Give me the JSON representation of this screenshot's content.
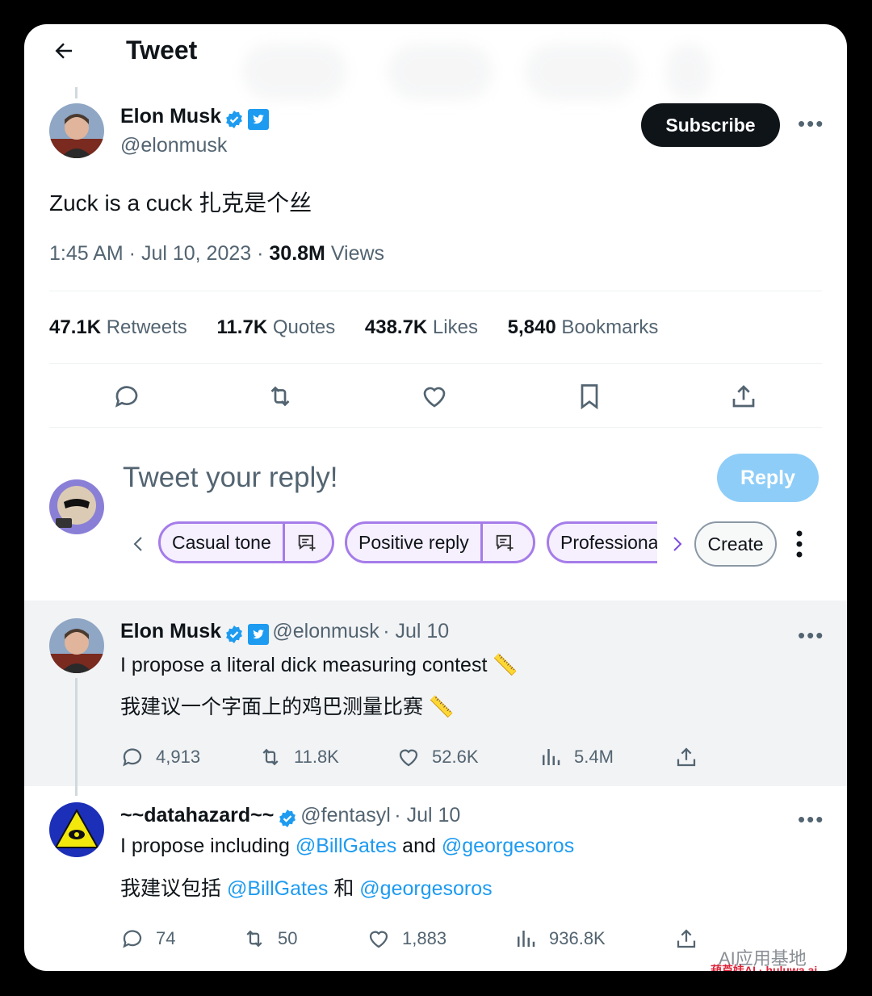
{
  "header": {
    "title": "Tweet"
  },
  "main_tweet": {
    "author_name": "Elon Musk",
    "handle": "@elonmusk",
    "subscribe_label": "Subscribe",
    "text": "Zuck is a cuck 扎克是个丝",
    "time": "1:45 AM · Jul 10, 2023 · ",
    "views_count": "30.8M",
    "views_label": " Views",
    "stats": [
      {
        "count": "47.1K",
        "label": " Retweets"
      },
      {
        "count": "11.7K",
        "label": " Quotes"
      },
      {
        "count": "438.7K",
        "label": " Likes"
      },
      {
        "count": "5,840",
        "label": " Bookmarks"
      }
    ]
  },
  "reply_composer": {
    "prompt": "Tweet your reply!",
    "reply_label": "Reply",
    "chips": [
      "Casual tone",
      "Positive reply",
      "Professional"
    ],
    "create_label": "Create"
  },
  "replies": [
    {
      "author_name": "Elon Musk",
      "handle": "@elonmusk",
      "date": "· Jul 10",
      "line1": "I propose a literal dick measuring contest 📏",
      "line2": "我建议一个字面上的鸡巴测量比赛 📏",
      "replies": "4,913",
      "retweets": "11.8K",
      "likes": "52.6K",
      "views": "5.4M"
    },
    {
      "author_name": "~~datahazard~~",
      "handle": "@fentasyl",
      "date": "· Jul 10",
      "line1_a": "I propose including ",
      "mention1": "@BillGates",
      "line1_b": " and ",
      "mention2": "@georgesoros",
      "line2_a": "我建议包括 ",
      "line2_b": " 和 ",
      "replies": "74",
      "retweets": "50",
      "likes": "1,883",
      "views": "936.8K"
    }
  ],
  "watermark": {
    "text1": "AI应用基地",
    "text2": "葫芦娃AI · huluwa.ai"
  },
  "colors": {
    "accent": "#1d9bf0",
    "chip_border": "#a57ce9",
    "reply_button": "#8ecdf8"
  }
}
